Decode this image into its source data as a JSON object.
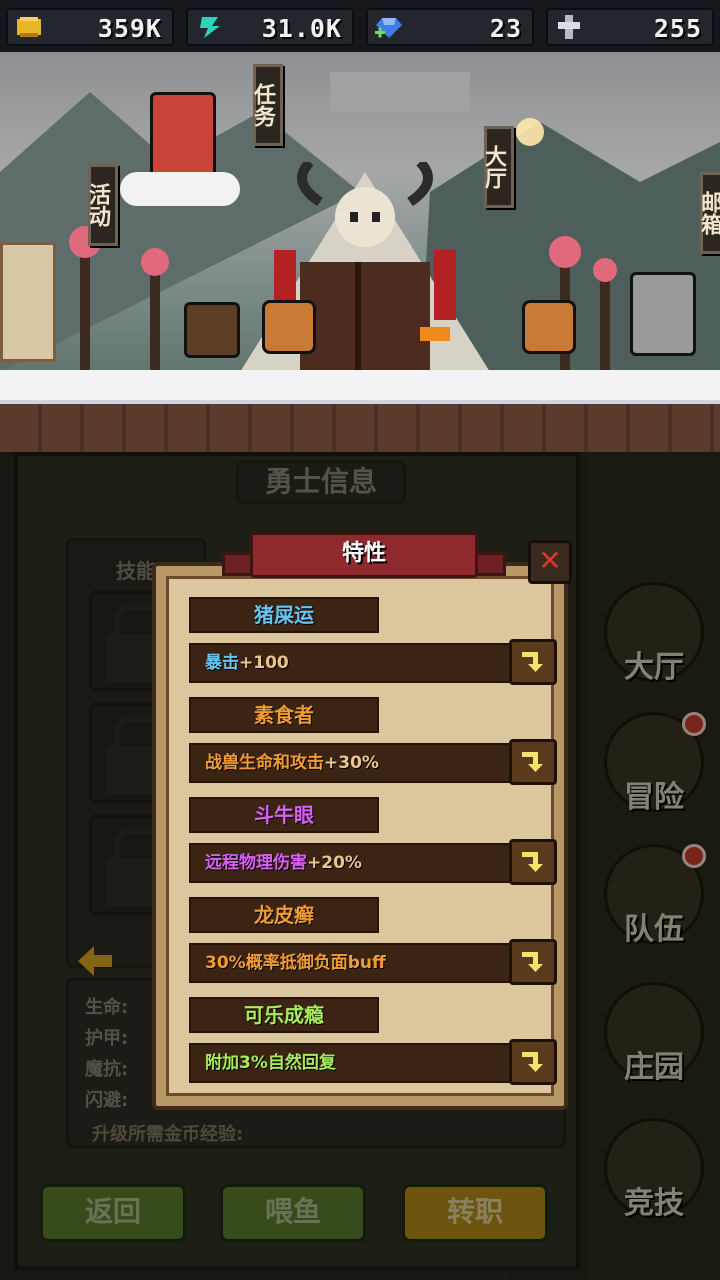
{
  "resources": [
    {
      "icon": "gold-coin-icon",
      "value": "359K"
    },
    {
      "icon": "green-crystal-icon",
      "value": "31.0K"
    },
    {
      "icon": "blue-gem-icon",
      "value": "23"
    },
    {
      "icon": "cross-token-icon",
      "value": "255"
    }
  ],
  "scene": {
    "banners": [
      "任务",
      "活动",
      "大厅",
      "邮箱"
    ]
  },
  "panel": {
    "title": "勇士信息",
    "skills_label": "技能",
    "stats": [
      "生命:",
      "护甲:",
      "魔抗:",
      "闪避:"
    ],
    "upgrade_text": "升级所需金币经验:",
    "buttons": {
      "back": "返回",
      "feed": "喂鱼",
      "transfer": "转职"
    }
  },
  "nav": [
    {
      "label": "大厅",
      "badge": false
    },
    {
      "label": "冒险",
      "badge": true
    },
    {
      "label": "队伍",
      "badge": true
    },
    {
      "label": "庄园",
      "badge": false
    },
    {
      "label": "竞技",
      "badge": false
    }
  ],
  "dialog": {
    "title": "特性",
    "close": "✕",
    "traits": [
      {
        "name": "猪屎运",
        "desc_main": "暴击",
        "desc_bonus": "+100",
        "color": "#66c4f2",
        "tier": "blue"
      },
      {
        "name": "素食者",
        "desc_main": "战兽生命和攻击",
        "desc_bonus": "+30%",
        "color": "#f29b34",
        "tier": "orange"
      },
      {
        "name": "斗牛眼",
        "desc_main": "远程物理伤害",
        "desc_bonus": "+20%",
        "color": "#d960f5",
        "tier": "purple"
      },
      {
        "name": "龙皮癣",
        "desc_main": "30%概率抵御负面buff",
        "desc_bonus": "",
        "color": "#f29b34",
        "tier": "orange"
      },
      {
        "name": "可乐成瘾",
        "desc_main": "附加3%自然回复",
        "desc_bonus": "",
        "color": "#a6ec5c",
        "tier": "green"
      }
    ]
  }
}
